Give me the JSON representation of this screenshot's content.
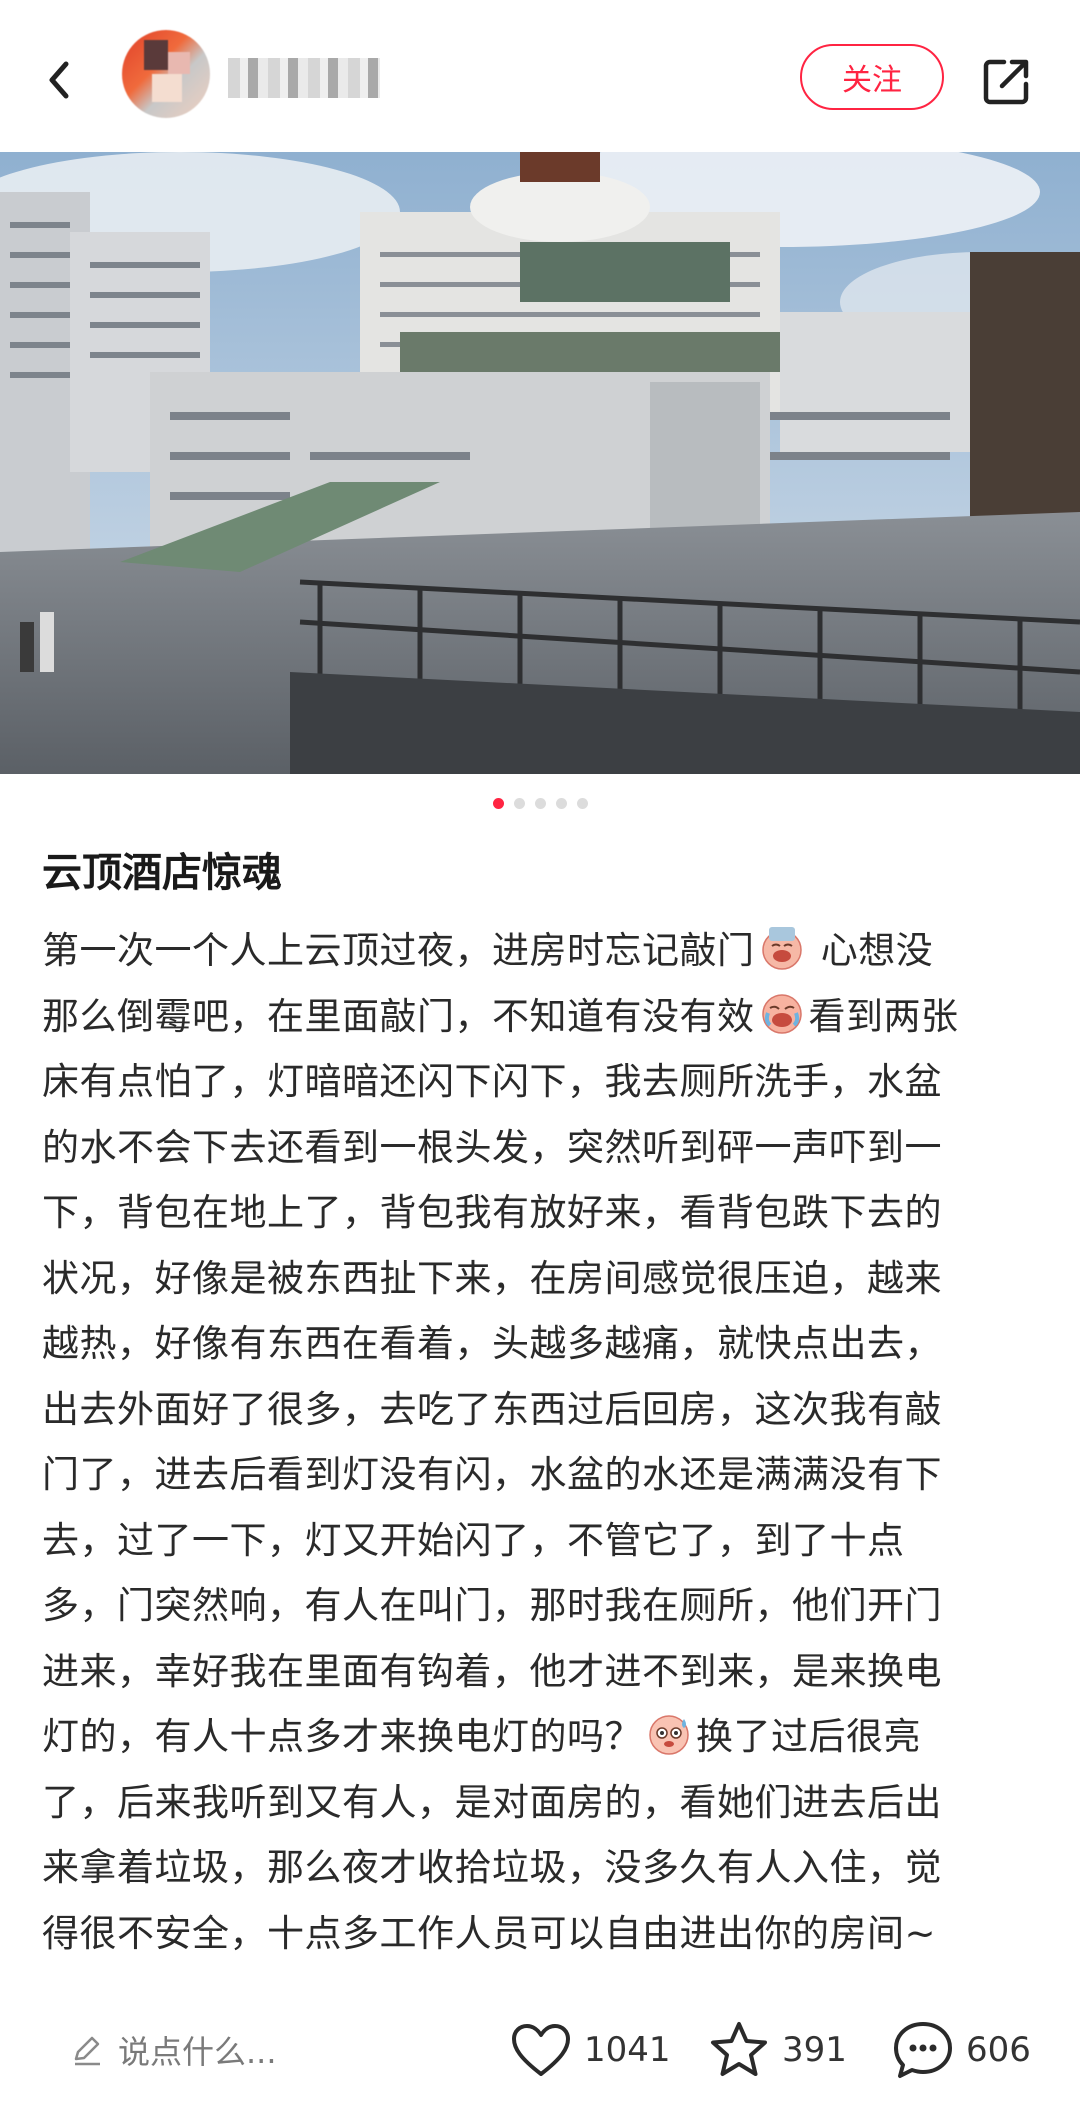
{
  "header": {
    "author_name": "",
    "follow_label": "关注"
  },
  "carousel": {
    "total": 5,
    "active_index": 0
  },
  "post": {
    "title": "云顶酒店惊魂",
    "lines": [
      [
        "第一次一个人上云顶过夜，进房时忘记敲门",
        "emoji-cry-cold",
        " 心想没"
      ],
      [
        "那么倒霉吧，在里面敲门，不知道有没有效",
        "emoji-cry-loud",
        "看到两张"
      ],
      [
        "床有点怕了，灯暗暗还闪下闪下，我去厕所洗手，水盆"
      ],
      [
        "的水不会下去还看到一根头发，突然听到砰一声吓到一"
      ],
      [
        "下，背包在地上了，背包我有放好来，看背包跌下去的"
      ],
      [
        "状况，好像是被东西扯下来，在房间感觉很压迫，越来"
      ],
      [
        "越热，好像有东西在看着，头越多越痛，就快点出去，"
      ],
      [
        "出去外面好了很多，去吃了东西过后回房，这次我有敲"
      ],
      [
        "门了，进去后看到灯没有闪，水盆的水还是满满没有下"
      ],
      [
        "去，过了一下，灯又开始闪了，不管它了，到了十点"
      ],
      [
        "多，门突然响，有人在叫门，那时我在厕所，他们开门"
      ],
      [
        "进来，幸好我在里面有钩着，他才进不到来，是来换电"
      ],
      [
        "灯的，有人十点多才来换电灯的吗？",
        "emoji-sweat",
        "换了过后很亮"
      ],
      [
        "了，后来我听到又有人，是对面房的，看她们进去后出"
      ],
      [
        "来拿着垃圾，那么夜才收拾垃圾，没多久有人入住，觉"
      ],
      [
        "得很不安全，十点多工作人员可以自由进出你的房间~"
      ]
    ]
  },
  "bottom_bar": {
    "comment_placeholder": "说点什么...",
    "likes": "1041",
    "collects": "391",
    "comments": "606"
  },
  "colors": {
    "accent": "#ff2442"
  }
}
